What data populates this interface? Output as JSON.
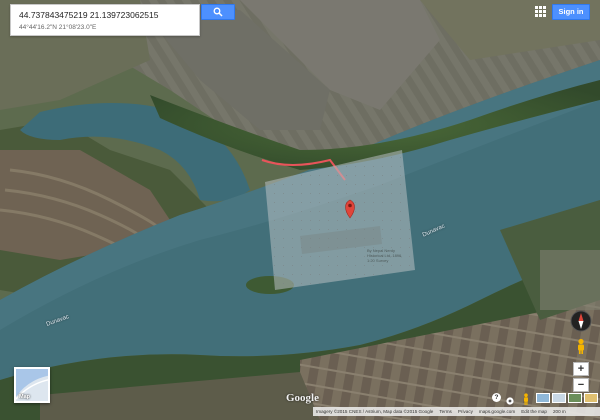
{
  "search": {
    "value": "44.737843475219 21.139723062515",
    "subtitle": "44°44'16.2\"N 21°08'23.0\"E"
  },
  "header": {
    "signin_label": "Sign in"
  },
  "map": {
    "view": "satellite",
    "river_labels": [
      "Dunavac",
      "Dunavac"
    ],
    "overlay_caption": "By Nepal Nerdy Historical Ltd, 1896, 1:20 Survey",
    "colors": {
      "river": "#3e6f78",
      "farmland": "#6b6b5c",
      "forest": "#3a5231",
      "pin": "#e0453a",
      "route": "#e8545a",
      "overlay": "#b8bfc2"
    }
  },
  "controls": {
    "zoom_in": "+",
    "zoom_out": "−",
    "minimap_label": "Map",
    "help_label": "?",
    "logo_text": "Google"
  },
  "footer": {
    "imagery": "Imagery ©2015 CNES / Astrium, Map data ©2015 Google",
    "links": [
      "Terms",
      "Privacy",
      "maps.google.com",
      "Edit the map"
    ],
    "scale": "200 m"
  }
}
